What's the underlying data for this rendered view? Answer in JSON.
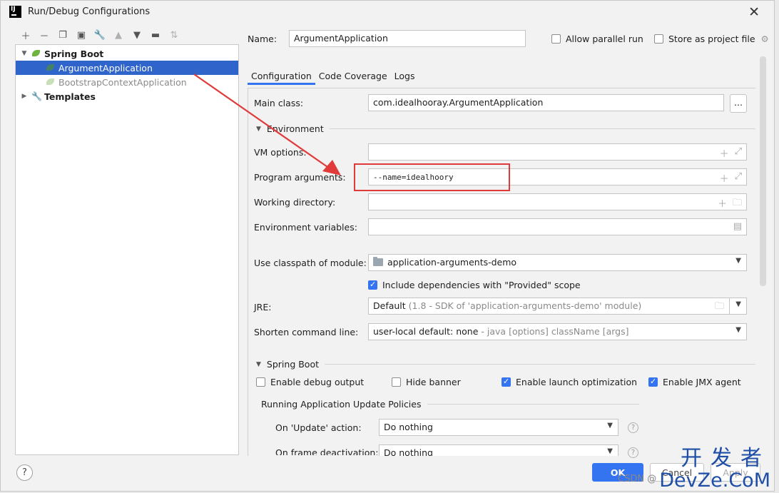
{
  "window": {
    "title": "Run/Debug Configurations",
    "logo_text": "IJ"
  },
  "tree_toolbar": {
    "icons": [
      "plus-icon",
      "minus-icon",
      "copy-icon",
      "save-icon",
      "wrench-icon",
      "arrow-up-icon",
      "arrow-down-icon",
      "new-folder-icon",
      "sort-icon"
    ]
  },
  "tree": {
    "spring_boot": "Spring Boot",
    "argument_app": "ArgumentApplication",
    "bootstrap_app": "BootstrapContextApplication",
    "templates": "Templates"
  },
  "header": {
    "name_label": "Name:",
    "name_value": "ArgumentApplication",
    "allow_parallel": "Allow parallel run",
    "store_as_project": "Store as project file"
  },
  "tabs": [
    "Configuration",
    "Code Coverage",
    "Logs"
  ],
  "form": {
    "main_class_label": "Main class:",
    "main_class_value": "com.idealhooray.ArgumentApplication",
    "browse": "...",
    "environment_header": "Environment",
    "vm_options_label": "VM options:",
    "vm_options_value": "",
    "program_args_label": "Program arguments:",
    "program_args_value": "--name=idealhoory",
    "working_dir_label": "Working directory:",
    "working_dir_value": "",
    "env_vars_label": "Environment variables:",
    "env_vars_value": "",
    "classpath_label": "Use classpath of module:",
    "classpath_value": "application-arguments-demo",
    "include_deps": "Include dependencies with \"Provided\" scope",
    "jre_label": "JRE:",
    "jre_value": "Default",
    "jre_hint": "(1.8 - SDK of 'application-arguments-demo' module)",
    "shorten_label": "Shorten command line:",
    "shorten_value": "user-local default: none",
    "shorten_hint": "- java [options] className [args]",
    "spring_boot_header": "Spring Boot",
    "enable_debug": "Enable debug output",
    "hide_banner": "Hide banner",
    "enable_launch_opt": "Enable launch optimization",
    "enable_jmx": "Enable JMX agent",
    "update_policies_header": "Running Application Update Policies",
    "on_update_label": "On 'Update' action:",
    "on_update_value": "Do nothing",
    "on_frame_label": "On frame deactivation:",
    "on_frame_value": "Do nothing"
  },
  "buttons": {
    "help": "?",
    "ok": "OK",
    "cancel": "Cancel",
    "apply": "Apply"
  },
  "watermark": {
    "top": "开发者",
    "bottom": "DevZe.CoM",
    "csdn": "CSDN @"
  },
  "colors": {
    "accent": "#3574f0",
    "selection": "#2f65ca",
    "annotation": "#e03a3a",
    "watermark": "#1e4ea6"
  }
}
